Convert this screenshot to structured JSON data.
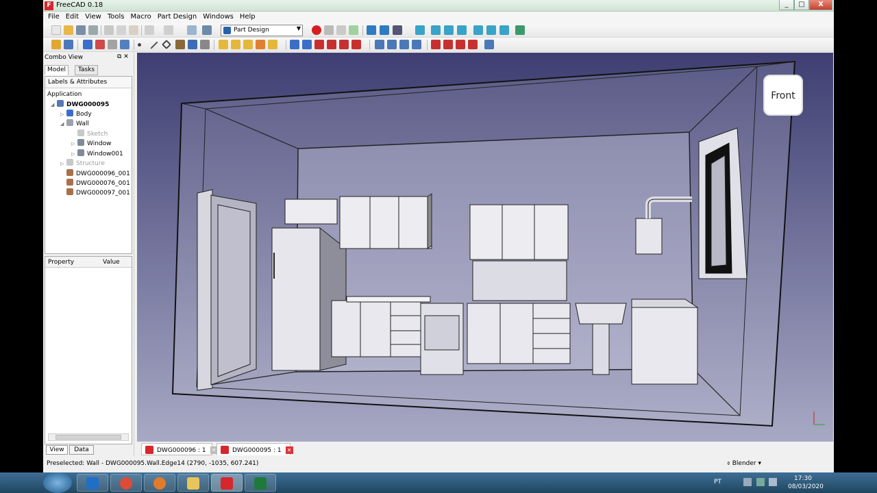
{
  "window": {
    "title": "FreeCAD 0.18",
    "controls": [
      "_",
      "□",
      "X"
    ]
  },
  "menu": [
    "File",
    "Edit",
    "View",
    "Tools",
    "Macro",
    "Part Design",
    "Windows",
    "Help"
  ],
  "toolbar": {
    "workbench": "Part Design"
  },
  "combo": {
    "title": "Combo View",
    "tabs": {
      "model": "Model",
      "tasks": "Tasks"
    },
    "labels_header": "Labels & Attributes",
    "application": "Application",
    "tree": [
      {
        "label": "DWG000095",
        "icon": "document-icon"
      },
      {
        "label": "Body",
        "icon": "body-icon"
      },
      {
        "label": "Wall",
        "icon": "wall-icon"
      },
      {
        "label": "Sketch",
        "icon": "sketch-icon"
      },
      {
        "label": "Window",
        "icon": "window-icon"
      },
      {
        "label": "Window001",
        "icon": "window-icon"
      },
      {
        "label": "Structure",
        "icon": "structure-icon"
      },
      {
        "label": "DWG000096_001",
        "icon": "part-icon"
      },
      {
        "label": "DWG000076_001",
        "icon": "part-icon"
      },
      {
        "label": "DWG000097_001",
        "icon": "part-icon"
      }
    ],
    "property_header": {
      "property": "Property",
      "value": "Value"
    },
    "bottom_tabs": {
      "view": "View",
      "data": "Data"
    }
  },
  "navcube": {
    "face": "Front"
  },
  "doc_tabs": [
    {
      "label": "DWG000096 : 1"
    },
    {
      "label": "DWG000095 : 1"
    }
  ],
  "status": {
    "preselected": "Preselected: Wall - DWG000095.Wall.Edge14 (2790, -1035, 607.241)",
    "navstyle": "Blender"
  },
  "taskbar": {
    "lang": "PT",
    "time": "17:30",
    "date": "08/03/2020"
  },
  "colors": {
    "accent_red": "#d7262c",
    "background_top": "#3e3e72",
    "background_bottom": "#a7a9c4"
  }
}
